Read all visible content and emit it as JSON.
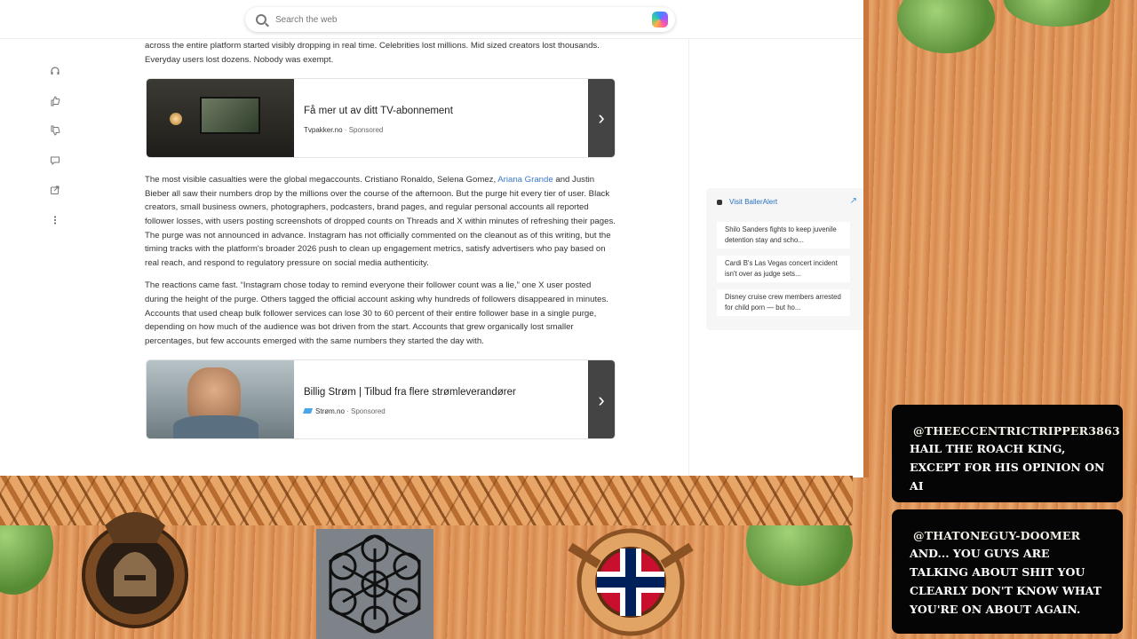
{
  "browser": {
    "search_placeholder": "Search the web"
  },
  "article": {
    "intro": "across the entire platform started visibly dropping in real time. Celebrities lost millions. Mid sized creators lost thousands. Everyday users lost dozens. Nobody was exempt.",
    "ads": [
      {
        "title": "Få mer ut av ditt TV-abonnement",
        "source": "Tvpakker.no",
        "sponsored": "Sponsored"
      },
      {
        "title": "Billig Strøm | Tilbud fra flere strømleverandører",
        "source": "Strøm.no",
        "sponsored": "Sponsored"
      }
    ],
    "p1_a": "The most visible casualties were the global megaccounts. Cristiano Ronaldo, Selena Gomez, ",
    "p1_link": "Ariana Grande",
    "p1_b": " and Justin Bieber all saw their numbers drop by the millions over the course of the afternoon. But the purge hit every tier of user. Black creators, small business owners, photographers, podcasters, brand pages, and regular personal accounts all reported follower losses, with users posting screenshots of dropped counts on Threads and X within minutes of refreshing their pages. The purge was not announced in advance. Instagram has not officially commented on the cleanout as of this writing, but the timing tracks with the platform's broader 2026 push to clean up engagement metrics, satisfy advertisers who pay based on real reach, and respond to regulatory pressure on social media authenticity.",
    "p2": "The reactions came fast. “Instagram chose today to remind everyone their follower count was a lie,” one X user posted during the height of the purge. Others tagged the official account asking why hundreds of followers disappeared in minutes. Accounts that used cheap bulk follower services can lose 30 to 60 percent of their entire follower base in a single purge, depending on how much of the audience was bot driven from the start. Accounts that grew organically lost smaller percentages, but few accounts emerged with the same numbers they started the day with."
  },
  "rail": {
    "visit_label": "Visit BallerAlert",
    "items": [
      "Shilo Sanders fights to keep juvenile detention stay and scho...",
      "Cardi B's Las Vegas concert incident isn't over as judge sets...",
      "Disney cruise crew members arrested for child porn — but ho..."
    ]
  },
  "chat": [
    {
      "user": "@THEECCENTRICTRIPPER3863",
      "message": "HAIL THE ROACH KING, EXCEPT FOR HIS OPINION ON AI"
    },
    {
      "user": "@THATONEGUY-DOOMER",
      "message": "AND... YOU GUYS ARE TALKING ABOUT SHIT YOU CLEARLY DON'T KNOW WHAT YOU'RE ON ABOUT AGAIN."
    }
  ],
  "icons": {
    "left_toolbar": [
      "headphones-icon",
      "thumbs-up-icon",
      "thumbs-down-icon",
      "comment-icon",
      "share-icon",
      "more-options-icon"
    ]
  },
  "colors": {
    "link": "#3a79c9",
    "overlay_wood": "#d98a4a",
    "vine_green": "#6fae4a"
  }
}
